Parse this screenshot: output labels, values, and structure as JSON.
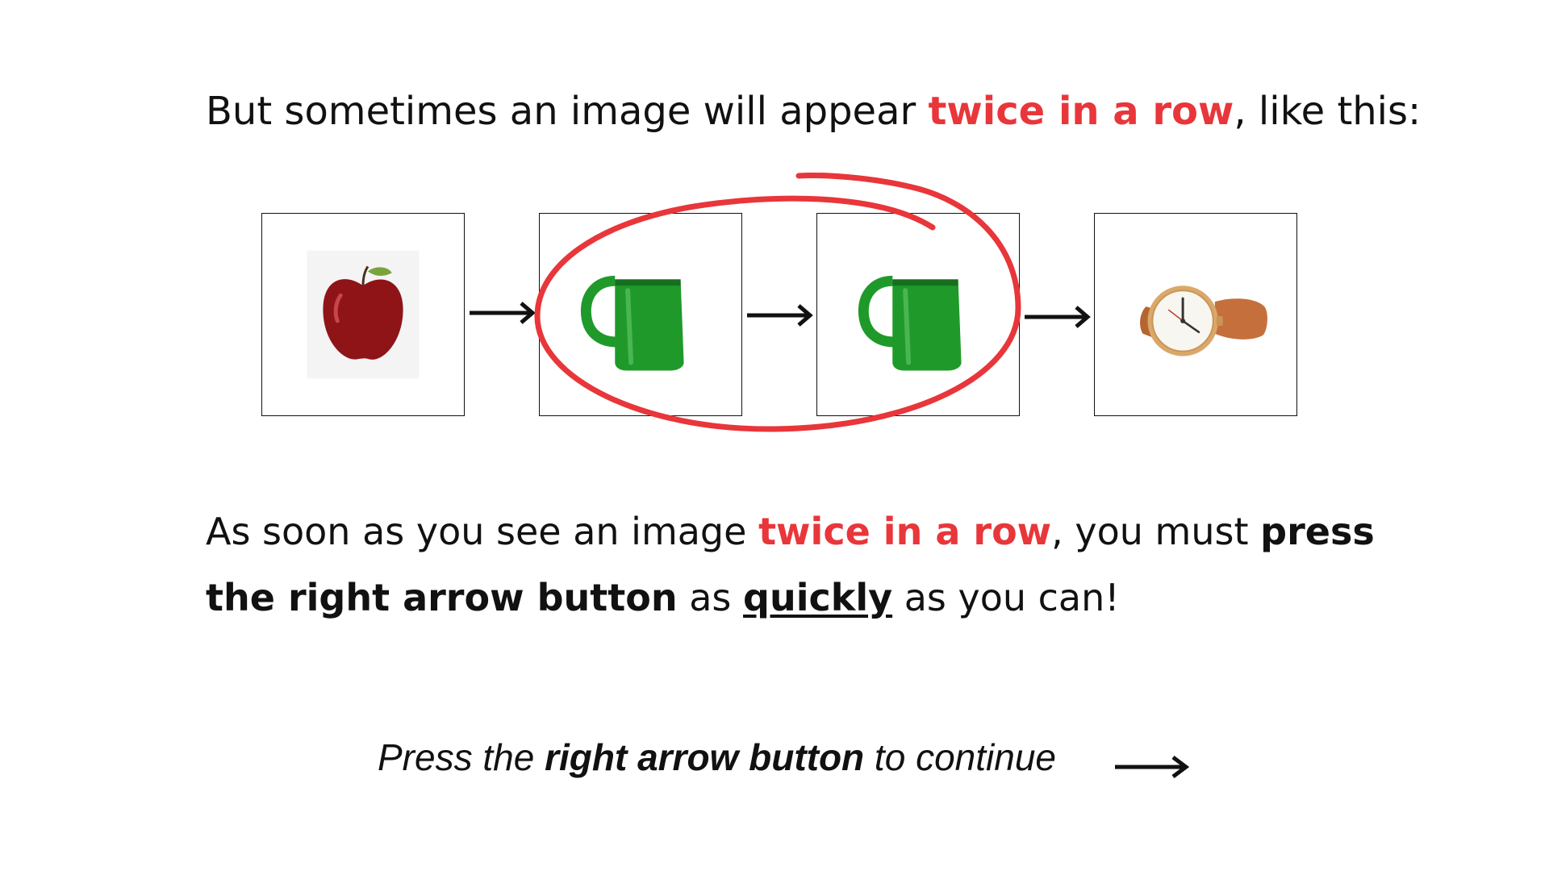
{
  "intro": {
    "before": "But sometimes an image will appear ",
    "highlight": "twice in a row",
    "after": ", like this:"
  },
  "sequence": {
    "images": [
      {
        "name": "apple",
        "icon": "apple-icon"
      },
      {
        "name": "green mug",
        "icon": "mug-icon"
      },
      {
        "name": "green mug",
        "icon": "mug-icon"
      },
      {
        "name": "wristwatch",
        "icon": "watch-icon"
      }
    ],
    "highlight_color": "#e8363a"
  },
  "instruction": {
    "part1": "As soon as you see an image ",
    "highlight": "twice in a row",
    "part2": ", you must ",
    "bold1": "press the right arrow button",
    "part3": " as ",
    "underlined": "quickly",
    "part4": " as you can!"
  },
  "footer": {
    "before": "Press the ",
    "bold": "right arrow button",
    "after": " to continue"
  },
  "colors": {
    "accent_red": "#e8363a",
    "text": "#111111",
    "mug_green": "#1f9a2a",
    "apple_red": "#8e1418"
  }
}
